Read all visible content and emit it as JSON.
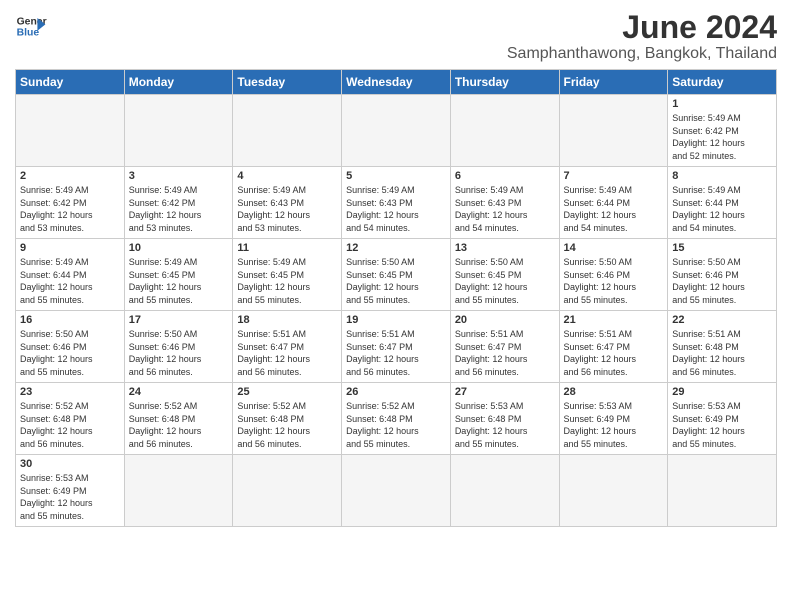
{
  "logo": {
    "line1": "General",
    "line2": "Blue"
  },
  "title": "June 2024",
  "subtitle": "Samphanthawong, Bangkok, Thailand",
  "weekdays": [
    "Sunday",
    "Monday",
    "Tuesday",
    "Wednesday",
    "Thursday",
    "Friday",
    "Saturday"
  ],
  "weeks": [
    [
      {
        "day": "",
        "info": ""
      },
      {
        "day": "",
        "info": ""
      },
      {
        "day": "",
        "info": ""
      },
      {
        "day": "",
        "info": ""
      },
      {
        "day": "",
        "info": ""
      },
      {
        "day": "",
        "info": ""
      },
      {
        "day": "1",
        "info": "Sunrise: 5:49 AM\nSunset: 6:42 PM\nDaylight: 12 hours\nand 52 minutes."
      }
    ],
    [
      {
        "day": "2",
        "info": "Sunrise: 5:49 AM\nSunset: 6:42 PM\nDaylight: 12 hours\nand 53 minutes."
      },
      {
        "day": "3",
        "info": "Sunrise: 5:49 AM\nSunset: 6:42 PM\nDaylight: 12 hours\nand 53 minutes."
      },
      {
        "day": "4",
        "info": "Sunrise: 5:49 AM\nSunset: 6:43 PM\nDaylight: 12 hours\nand 53 minutes."
      },
      {
        "day": "5",
        "info": "Sunrise: 5:49 AM\nSunset: 6:43 PM\nDaylight: 12 hours\nand 54 minutes."
      },
      {
        "day": "6",
        "info": "Sunrise: 5:49 AM\nSunset: 6:43 PM\nDaylight: 12 hours\nand 54 minutes."
      },
      {
        "day": "7",
        "info": "Sunrise: 5:49 AM\nSunset: 6:44 PM\nDaylight: 12 hours\nand 54 minutes."
      },
      {
        "day": "8",
        "info": "Sunrise: 5:49 AM\nSunset: 6:44 PM\nDaylight: 12 hours\nand 54 minutes."
      }
    ],
    [
      {
        "day": "9",
        "info": "Sunrise: 5:49 AM\nSunset: 6:44 PM\nDaylight: 12 hours\nand 55 minutes."
      },
      {
        "day": "10",
        "info": "Sunrise: 5:49 AM\nSunset: 6:45 PM\nDaylight: 12 hours\nand 55 minutes."
      },
      {
        "day": "11",
        "info": "Sunrise: 5:49 AM\nSunset: 6:45 PM\nDaylight: 12 hours\nand 55 minutes."
      },
      {
        "day": "12",
        "info": "Sunrise: 5:50 AM\nSunset: 6:45 PM\nDaylight: 12 hours\nand 55 minutes."
      },
      {
        "day": "13",
        "info": "Sunrise: 5:50 AM\nSunset: 6:45 PM\nDaylight: 12 hours\nand 55 minutes."
      },
      {
        "day": "14",
        "info": "Sunrise: 5:50 AM\nSunset: 6:46 PM\nDaylight: 12 hours\nand 55 minutes."
      },
      {
        "day": "15",
        "info": "Sunrise: 5:50 AM\nSunset: 6:46 PM\nDaylight: 12 hours\nand 55 minutes."
      }
    ],
    [
      {
        "day": "16",
        "info": "Sunrise: 5:50 AM\nSunset: 6:46 PM\nDaylight: 12 hours\nand 55 minutes."
      },
      {
        "day": "17",
        "info": "Sunrise: 5:50 AM\nSunset: 6:46 PM\nDaylight: 12 hours\nand 56 minutes."
      },
      {
        "day": "18",
        "info": "Sunrise: 5:51 AM\nSunset: 6:47 PM\nDaylight: 12 hours\nand 56 minutes."
      },
      {
        "day": "19",
        "info": "Sunrise: 5:51 AM\nSunset: 6:47 PM\nDaylight: 12 hours\nand 56 minutes."
      },
      {
        "day": "20",
        "info": "Sunrise: 5:51 AM\nSunset: 6:47 PM\nDaylight: 12 hours\nand 56 minutes."
      },
      {
        "day": "21",
        "info": "Sunrise: 5:51 AM\nSunset: 6:47 PM\nDaylight: 12 hours\nand 56 minutes."
      },
      {
        "day": "22",
        "info": "Sunrise: 5:51 AM\nSunset: 6:48 PM\nDaylight: 12 hours\nand 56 minutes."
      }
    ],
    [
      {
        "day": "23",
        "info": "Sunrise: 5:52 AM\nSunset: 6:48 PM\nDaylight: 12 hours\nand 56 minutes."
      },
      {
        "day": "24",
        "info": "Sunrise: 5:52 AM\nSunset: 6:48 PM\nDaylight: 12 hours\nand 56 minutes."
      },
      {
        "day": "25",
        "info": "Sunrise: 5:52 AM\nSunset: 6:48 PM\nDaylight: 12 hours\nand 56 minutes."
      },
      {
        "day": "26",
        "info": "Sunrise: 5:52 AM\nSunset: 6:48 PM\nDaylight: 12 hours\nand 55 minutes."
      },
      {
        "day": "27",
        "info": "Sunrise: 5:53 AM\nSunset: 6:48 PM\nDaylight: 12 hours\nand 55 minutes."
      },
      {
        "day": "28",
        "info": "Sunrise: 5:53 AM\nSunset: 6:49 PM\nDaylight: 12 hours\nand 55 minutes."
      },
      {
        "day": "29",
        "info": "Sunrise: 5:53 AM\nSunset: 6:49 PM\nDaylight: 12 hours\nand 55 minutes."
      }
    ],
    [
      {
        "day": "30",
        "info": "Sunrise: 5:53 AM\nSunset: 6:49 PM\nDaylight: 12 hours\nand 55 minutes."
      },
      {
        "day": "",
        "info": ""
      },
      {
        "day": "",
        "info": ""
      },
      {
        "day": "",
        "info": ""
      },
      {
        "day": "",
        "info": ""
      },
      {
        "day": "",
        "info": ""
      },
      {
        "day": "",
        "info": ""
      }
    ]
  ]
}
